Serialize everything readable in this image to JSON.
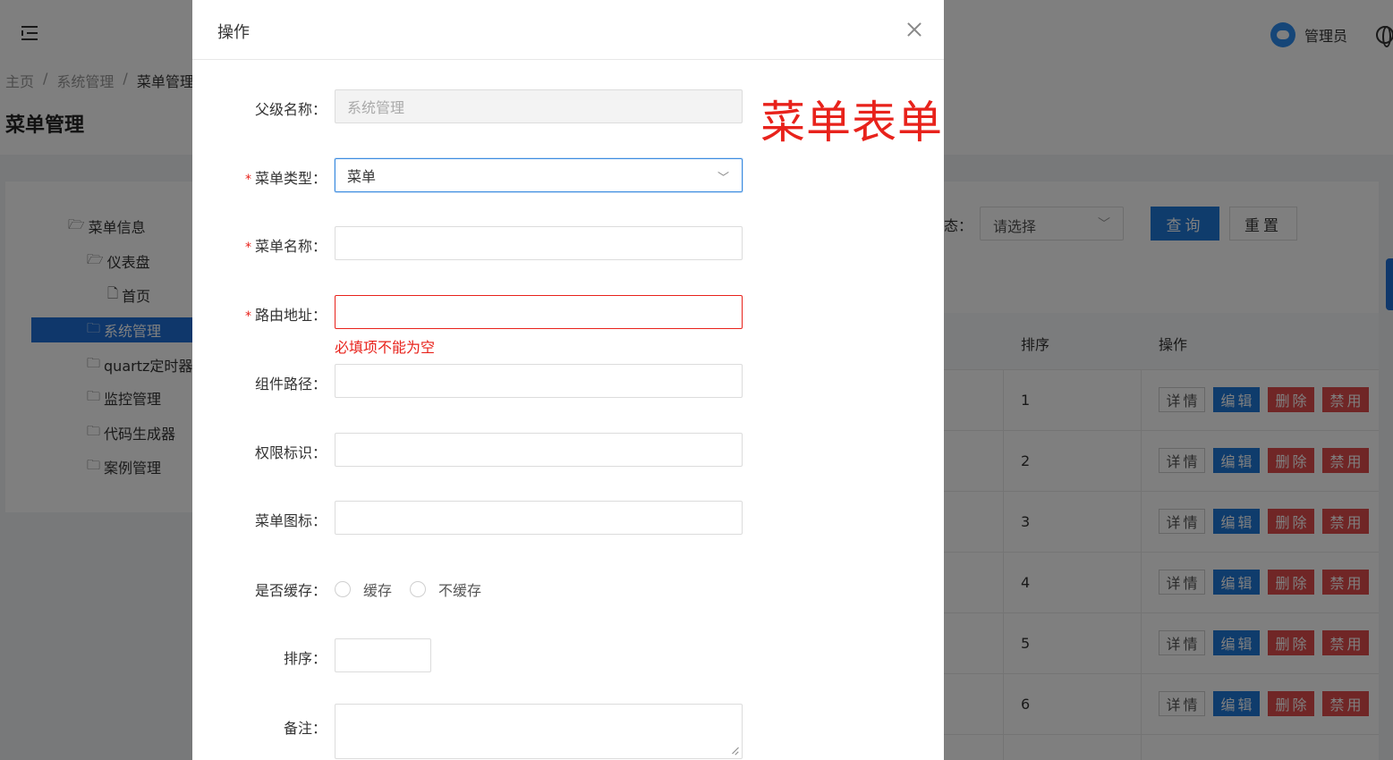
{
  "header": {
    "user_name": "管理员"
  },
  "breadcrumb": [
    "主页",
    "系统管理",
    "菜单管理"
  ],
  "page_title": "菜单管理",
  "tree": [
    {
      "label": "菜单信息",
      "icon": "folder-open-icon"
    },
    {
      "label": "仪表盘",
      "icon": "folder-open-icon"
    },
    {
      "label": "首页",
      "icon": "file-icon"
    },
    {
      "label": "系统管理",
      "icon": "folder-icon"
    },
    {
      "label": "quartz定时器",
      "icon": "folder-icon"
    },
    {
      "label": "监控管理",
      "icon": "folder-icon"
    },
    {
      "label": "代码生成器",
      "icon": "folder-icon"
    },
    {
      "label": "案例管理",
      "icon": "folder-icon"
    }
  ],
  "filter": {
    "status_label": "态：",
    "status_placeholder": "请选择",
    "query_label": "查询",
    "reset_label": "重置"
  },
  "table": {
    "headers": [
      "排序",
      "操作"
    ],
    "rows": [
      {
        "order": "1"
      },
      {
        "order": "2"
      },
      {
        "order": "3"
      },
      {
        "order": "4"
      },
      {
        "order": "5"
      },
      {
        "order": "6"
      }
    ],
    "actions": {
      "detail": "详情",
      "edit": "编辑",
      "delete": "删除",
      "disable": "禁用"
    }
  },
  "dialog": {
    "title": "操作",
    "annotation": "菜单表单",
    "fields": {
      "parent_name": {
        "label": "父级名称：",
        "value": "系统管理"
      },
      "menu_type": {
        "label": "菜单类型：",
        "value": "菜单",
        "required": "*"
      },
      "menu_name": {
        "label": "菜单名称：",
        "value": "",
        "required": "*"
      },
      "route": {
        "label": "路由地址：",
        "value": "",
        "required": "*",
        "error": "必填项不能为空"
      },
      "component": {
        "label": "组件路径：",
        "value": ""
      },
      "permission": {
        "label": "权限标识：",
        "value": ""
      },
      "icon": {
        "label": "菜单图标：",
        "value": ""
      },
      "cache": {
        "label": "是否缓存：",
        "options": [
          "缓存",
          "不缓存"
        ]
      },
      "sort": {
        "label": "排序：",
        "value": ""
      },
      "remark": {
        "label": "备注：",
        "value": ""
      }
    }
  },
  "colors": {
    "primary": "#1e78d8",
    "danger": "#e04c4c",
    "annotation": "#e8221b"
  }
}
